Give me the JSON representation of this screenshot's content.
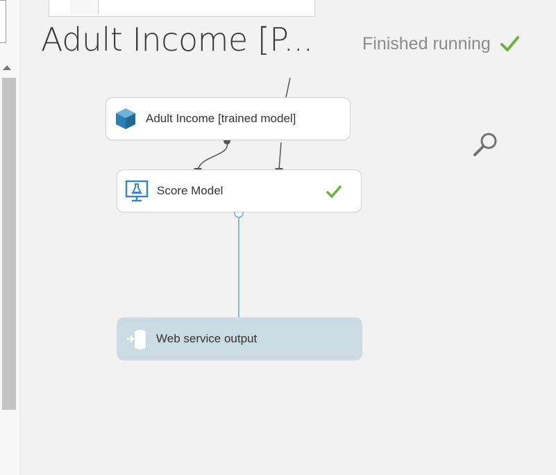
{
  "experiment": {
    "title": "Adult Income [P...",
    "status_text": "Finished running",
    "status_color": "#6bb23a"
  },
  "nodes": {
    "trained_model": {
      "label": "Adult Income [trained model]",
      "icon": "cube-icon"
    },
    "score_model": {
      "label": "Score Model",
      "icon": "flask-monitor-icon",
      "status": "completed"
    },
    "web_service_output": {
      "label": "Web service output",
      "icon": "service-output-icon"
    }
  },
  "colors": {
    "canvas": "#f2f2f2",
    "node_border": "#cfcfcf",
    "output_node": "#cbdbe4",
    "icon_blue": "#3a86b8",
    "connector_blue": "#8fb8d0"
  }
}
